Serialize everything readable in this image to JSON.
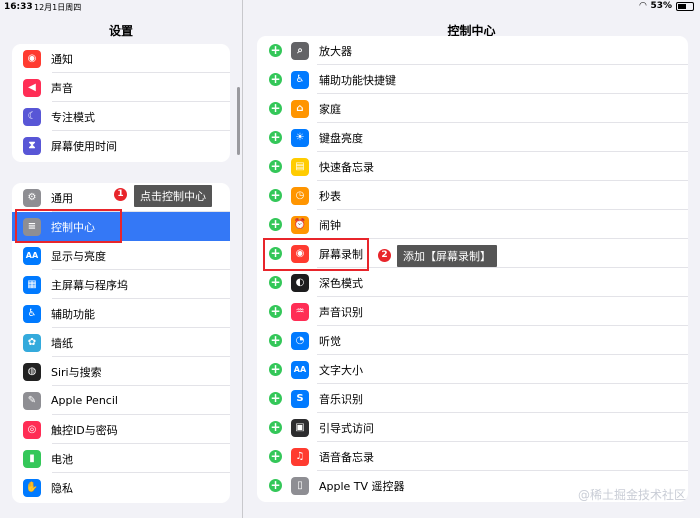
{
  "status": {
    "time": "16:33",
    "date": "12月1日周四",
    "battery": "53%"
  },
  "left_title": "设置",
  "right_title": "控制中心",
  "left_group1": [
    {
      "label": "通知",
      "icon": "bell-icon",
      "color": "#ff3b30",
      "glyph": "◉"
    },
    {
      "label": "声音",
      "icon": "speaker-icon",
      "color": "#ff2d55",
      "glyph": "◀"
    },
    {
      "label": "专注模式",
      "icon": "moon-icon",
      "color": "#5856d6",
      "glyph": "☾"
    },
    {
      "label": "屏幕使用时间",
      "icon": "hourglass-icon",
      "color": "#5856d6",
      "glyph": "⧗"
    }
  ],
  "left_group2": [
    {
      "label": "通用",
      "icon": "gear-icon",
      "color": "#8e8e93",
      "glyph": "⚙"
    },
    {
      "label": "控制中心",
      "icon": "toggles-icon",
      "color": "#8e8e93",
      "glyph": "≡"
    },
    {
      "label": "显示与亮度",
      "icon": "text-size-icon",
      "color": "#007aff",
      "glyph": "AA"
    },
    {
      "label": "主屏幕与程序坞",
      "icon": "grid-icon",
      "color": "#007aff",
      "glyph": "▦"
    },
    {
      "label": "辅助功能",
      "icon": "accessibility-icon",
      "color": "#007aff",
      "glyph": "♿"
    },
    {
      "label": "墙纸",
      "icon": "flower-icon",
      "color": "#34aadc",
      "glyph": "✿"
    },
    {
      "label": "Siri与搜索",
      "icon": "siri-icon",
      "color": "#222222",
      "glyph": "◍"
    },
    {
      "label": "Apple Pencil",
      "icon": "pencil-icon",
      "color": "#8e8e93",
      "glyph": "✎"
    },
    {
      "label": "触控ID与密码",
      "icon": "fingerprint-icon",
      "color": "#ff2d55",
      "glyph": "◎"
    },
    {
      "label": "电池",
      "icon": "battery-icon",
      "color": "#34c759",
      "glyph": "▮"
    },
    {
      "label": "隐私",
      "icon": "hand-icon",
      "color": "#007aff",
      "glyph": "✋"
    }
  ],
  "right_items": [
    {
      "label": "放大器",
      "icon": "magnifier-icon",
      "color": "#636366",
      "glyph": "⌕"
    },
    {
      "label": "辅助功能快捷键",
      "icon": "accessibility-icon",
      "color": "#007aff",
      "glyph": "♿"
    },
    {
      "label": "家庭",
      "icon": "home-icon",
      "color": "#ff9500",
      "glyph": "⌂"
    },
    {
      "label": "键盘亮度",
      "icon": "keyboard-brightness-icon",
      "color": "#007aff",
      "glyph": "☀"
    },
    {
      "label": "快速备忘录",
      "icon": "memo-icon",
      "color": "#ffcc00",
      "glyph": "▤"
    },
    {
      "label": "秒表",
      "icon": "stopwatch-icon",
      "color": "#ff9500",
      "glyph": "◷"
    },
    {
      "label": "闹钟",
      "icon": "alarm-icon",
      "color": "#ff9500",
      "glyph": "⏰"
    },
    {
      "label": "屏幕录制",
      "icon": "record-icon",
      "color": "#ff3b30",
      "glyph": "◉"
    },
    {
      "label": "深色模式",
      "icon": "dark-mode-icon",
      "color": "#1c1c1e",
      "glyph": "◐"
    },
    {
      "label": "声音识别",
      "icon": "sound-recognition-icon",
      "color": "#ff2d55",
      "glyph": "♒"
    },
    {
      "label": "听觉",
      "icon": "ear-icon",
      "color": "#007aff",
      "glyph": "◔"
    },
    {
      "label": "文字大小",
      "icon": "text-size-icon",
      "color": "#007aff",
      "glyph": "AA"
    },
    {
      "label": "音乐识别",
      "icon": "shazam-icon",
      "color": "#007aff",
      "glyph": "S"
    },
    {
      "label": "引导式访问",
      "icon": "lock-icon",
      "color": "#2c2c2e",
      "glyph": "▣"
    },
    {
      "label": "语音备忘录",
      "icon": "waveform-icon",
      "color": "#ff3b30",
      "glyph": "♫"
    },
    {
      "label": "Apple TV 遥控器",
      "icon": "remote-icon",
      "color": "#8e8e93",
      "glyph": "▯"
    }
  ],
  "annotations": {
    "step1_number": "1",
    "step1_text": "点击控制中心",
    "step2_number": "2",
    "step2_text": "添加【屏幕录制】"
  },
  "watermark": "@稀土掘金技术社区"
}
